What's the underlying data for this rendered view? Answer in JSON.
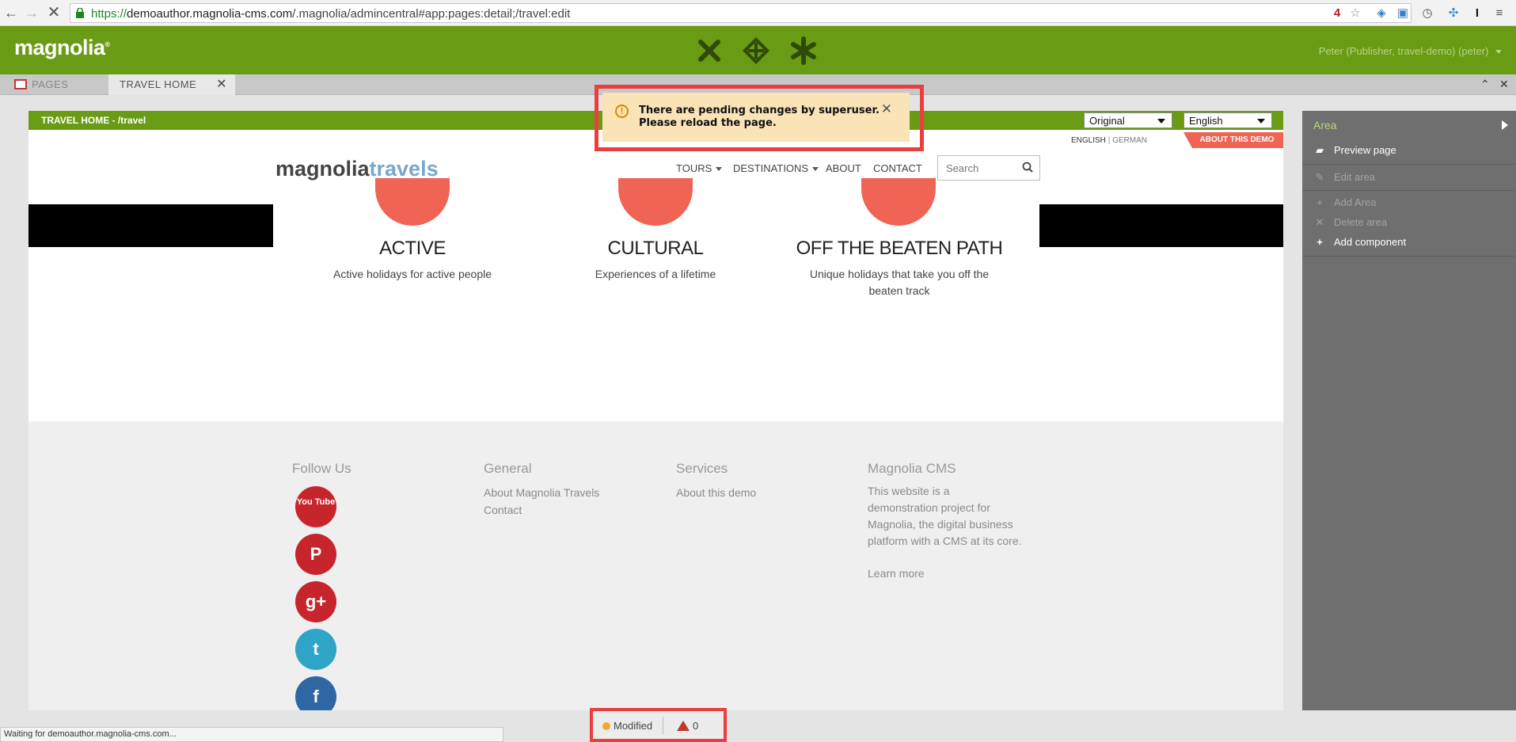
{
  "browser": {
    "url_scheme": "https://",
    "url_host": "demoauthor.magnolia-cms.com",
    "url_path": "/.magnolia/admincentral#app:pages:detail;/travel:edit",
    "status_text": "Waiting for demoauthor.magnolia-cms.com..."
  },
  "header": {
    "logo": "magnolia",
    "user": "Peter (Publisher, travel-demo) (peter)"
  },
  "tabs": {
    "pages": "PAGES",
    "travel_home": "TRAVEL HOME"
  },
  "page_strip": {
    "title": "TRAVEL HOME - /travel",
    "version_select": "Original",
    "language_select": "English"
  },
  "site": {
    "lang_english": "ENGLISH",
    "lang_sep": "|",
    "lang_german": "GERMAN",
    "about_demo": "ABOUT THIS DEMO",
    "logo_part1": "magnolia",
    "logo_part2": "travels",
    "nav": {
      "tours": "TOURS",
      "destinations": "DESTINATIONS",
      "about": "ABOUT",
      "contact": "CONTACT"
    },
    "search_placeholder": "Search",
    "features": [
      {
        "title": "ACTIVE",
        "desc": "Active holidays for active people"
      },
      {
        "title": "CULTURAL",
        "desc": "Experiences of a lifetime"
      },
      {
        "title": "OFF THE BEATEN PATH",
        "desc": "Unique holidays that take you off the beaten track"
      }
    ],
    "footer": {
      "follow_us": "Follow Us",
      "general": "General",
      "general_links": [
        "About Magnolia Travels",
        "Contact"
      ],
      "services": "Services",
      "services_links": [
        "About this demo"
      ],
      "cms": "Magnolia CMS",
      "cms_text": "This website is a demonstration project for Magnolia, the digital business platform with a  CMS at its core.",
      "learn_more": "Learn more",
      "social": [
        "YouTube",
        "Pinterest",
        "Google+",
        "Twitter",
        "Facebook"
      ],
      "social_glyphs": {
        "youtube": "You Tube",
        "pinterest": "P",
        "gplus": "g+",
        "twitter": "t",
        "facebook": "f"
      }
    }
  },
  "notice": {
    "line1": "There are pending changes by superuser.",
    "line2": "Please reload the page."
  },
  "action_panel": {
    "title": "Area",
    "items": [
      {
        "label": "Preview page",
        "enabled": true
      },
      {
        "label": "Edit area",
        "enabled": false
      },
      {
        "label": "Add Area",
        "enabled": false
      },
      {
        "label": "Delete area",
        "enabled": false
      },
      {
        "label": "Add component",
        "enabled": true
      }
    ]
  },
  "status": {
    "modified": "Modified",
    "warning_count": "0"
  },
  "colors": {
    "brand_green": "#6a9b14",
    "accent_coral": "#ef6454",
    "highlight_red": "#ea3f3f"
  }
}
